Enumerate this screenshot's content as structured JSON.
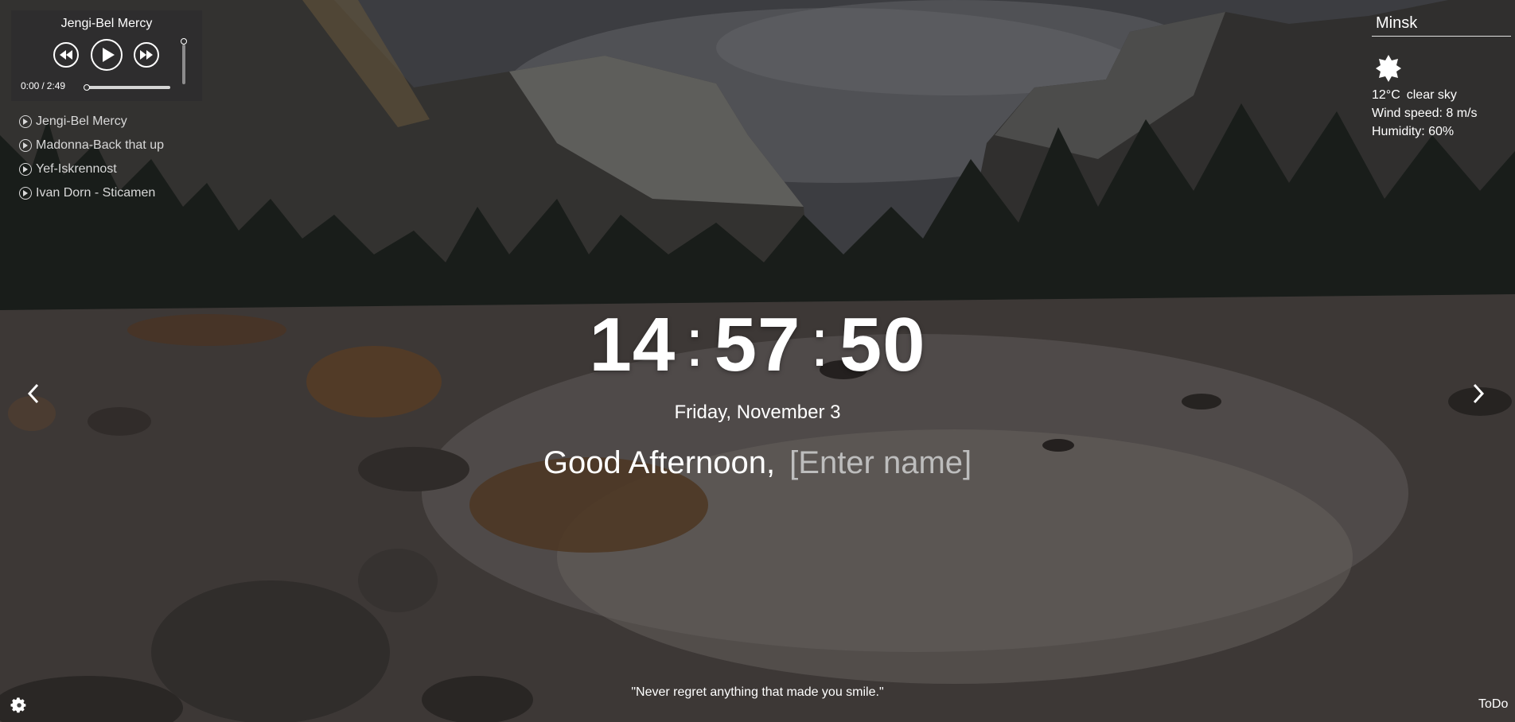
{
  "player": {
    "current_track": "Jengi-Bel Mercy",
    "time_current": "0:00",
    "time_separator": "/",
    "time_total": "2:49",
    "progress": 0,
    "volume": 1
  },
  "playlist": [
    "Jengi-Bel Mercy",
    "Madonna-Back that up",
    "Yef-Iskrennost",
    "Ivan Dorn - Sticamen"
  ],
  "weather": {
    "city": "Minsk",
    "icon": "sun-icon",
    "temperature": "12°C",
    "description": "clear sky",
    "wind": "Wind speed: 8 m/s",
    "humidity": "Humidity: 60%"
  },
  "clock": {
    "hours": "14",
    "minutes": "57",
    "seconds": "50",
    "separator": ":"
  },
  "date": "Friday, November 3",
  "greeting": {
    "text": "Good Afternoon,",
    "name_placeholder": "[Enter name]"
  },
  "quote": "\"Never regret anything that made you smile.\"",
  "todo_label": "ToDo",
  "icons": {
    "prev": "rewind-icon",
    "play": "play-icon",
    "next": "fast-forward-icon",
    "settings": "gear-icon",
    "slide_prev": "chevron-left-icon",
    "slide_next": "chevron-right-icon"
  }
}
